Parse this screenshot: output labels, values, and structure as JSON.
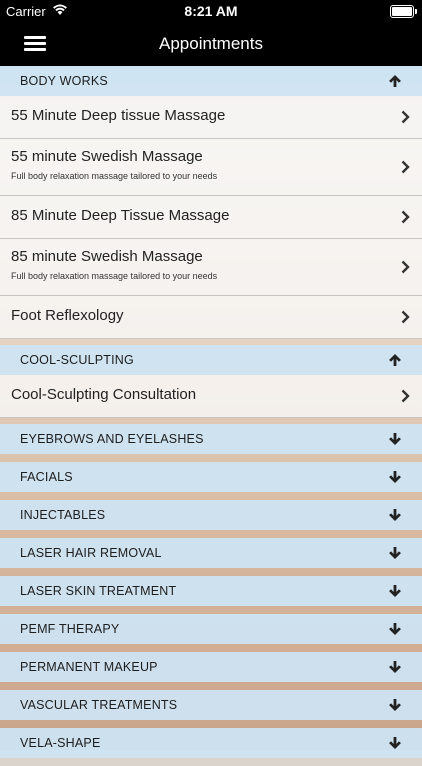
{
  "status_bar": {
    "carrier": "Carrier",
    "time": "8:21 AM"
  },
  "header": {
    "title": "Appointments"
  },
  "sections": [
    {
      "title": "BODY WORKS",
      "expanded": true,
      "items": [
        {
          "name": "55 Minute Deep tissue Massage",
          "description": ""
        },
        {
          "name": "55 minute Swedish Massage",
          "description": "Full body relaxation massage tailored to your needs"
        },
        {
          "name": "85 Minute Deep Tissue Massage",
          "description": ""
        },
        {
          "name": "85 minute Swedish Massage",
          "description": "Full body relaxation massage tailored to your needs"
        },
        {
          "name": "Foot Reflexology",
          "description": ""
        }
      ]
    },
    {
      "title": "COOL-SCULPTING",
      "expanded": true,
      "items": [
        {
          "name": "Cool-Sculpting Consultation",
          "description": ""
        }
      ]
    },
    {
      "title": "EYEBROWS AND EYELASHES",
      "expanded": false,
      "items": []
    },
    {
      "title": "FACIALS",
      "expanded": false,
      "items": []
    },
    {
      "title": "INJECTABLES",
      "expanded": false,
      "items": []
    },
    {
      "title": "LASER HAIR REMOVAL",
      "expanded": false,
      "items": []
    },
    {
      "title": "LASER SKIN TREATMENT",
      "expanded": false,
      "items": []
    },
    {
      "title": "PEMF THERAPY",
      "expanded": false,
      "items": []
    },
    {
      "title": "PERMANENT MAKEUP",
      "expanded": false,
      "items": []
    },
    {
      "title": "VASCULAR TREATMENTS",
      "expanded": false,
      "items": []
    },
    {
      "title": "VELA-SHAPE",
      "expanded": false,
      "items": []
    }
  ],
  "colors": {
    "section_bg": "#cde4f4",
    "header_bg": "#000000",
    "item_bg": "#f8f7f6"
  }
}
